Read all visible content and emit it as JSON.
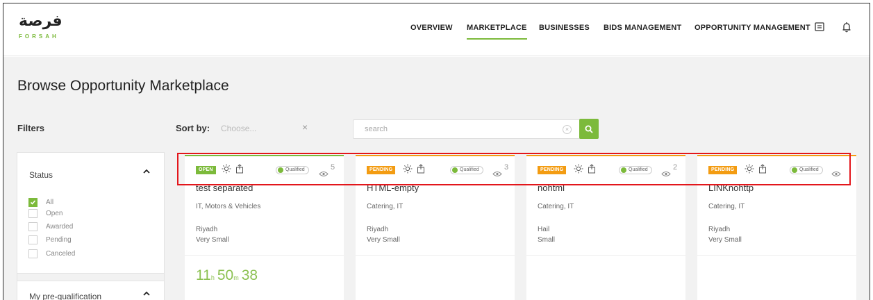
{
  "brand": {
    "arabic": "فرصة",
    "latin": "FORSAH"
  },
  "nav": [
    {
      "label": "OVERVIEW",
      "active": false
    },
    {
      "label": "MARKETPLACE",
      "active": true
    },
    {
      "label": "BUSINESSES",
      "active": false
    },
    {
      "label": "BIDS MANAGEMENT",
      "active": false
    },
    {
      "label": "OPPORTUNITY MANAGEMENT",
      "active": false
    }
  ],
  "header_icons": [
    "message-icon",
    "bell-icon"
  ],
  "page": {
    "title": "Browse Opportunity Marketplace"
  },
  "filters": {
    "title": "Filters",
    "status": {
      "heading": "Status",
      "options": [
        {
          "label": "All",
          "checked": true
        },
        {
          "label": "Open",
          "checked": false
        },
        {
          "label": "Awarded",
          "checked": false
        },
        {
          "label": "Pending",
          "checked": false
        },
        {
          "label": "Canceled",
          "checked": false
        }
      ]
    },
    "prequal": {
      "heading": "My pre-qualification"
    }
  },
  "toolbar": {
    "sort_label": "Sort by:",
    "sort_placeholder": "Choose...",
    "sort_clear": "×",
    "search_placeholder": "search"
  },
  "cards": [
    {
      "status": "OPEN",
      "qualified": "Qualified",
      "views": "5",
      "title": "test separated",
      "categories": "IT, Motors & Vehicles",
      "location": "Riyadh",
      "size": "Very Small",
      "timer": {
        "hours": "11",
        "h_unit": "h",
        "minutes": "50",
        "m_unit": "m",
        "seconds": "38"
      }
    },
    {
      "status": "PENDING",
      "qualified": "Qualified",
      "views": "3",
      "title": "HTML-empty",
      "categories": "Catering, IT",
      "location": "Riyadh",
      "size": "Very Small"
    },
    {
      "status": "PENDING",
      "qualified": "Qualified",
      "views": "2",
      "title": "nohtml",
      "categories": "Catering, IT",
      "location": "Hail",
      "size": "Small"
    },
    {
      "status": "PENDING",
      "qualified": "Qualified",
      "views": "",
      "title": "LINKnohttp",
      "categories": "Catering, IT",
      "location": "Riyadh",
      "size": "Very Small"
    }
  ],
  "colors": {
    "accent": "#7cba3b",
    "pending": "#f39c12",
    "highlight": "#e3161b",
    "background": "#f2f2f2"
  }
}
